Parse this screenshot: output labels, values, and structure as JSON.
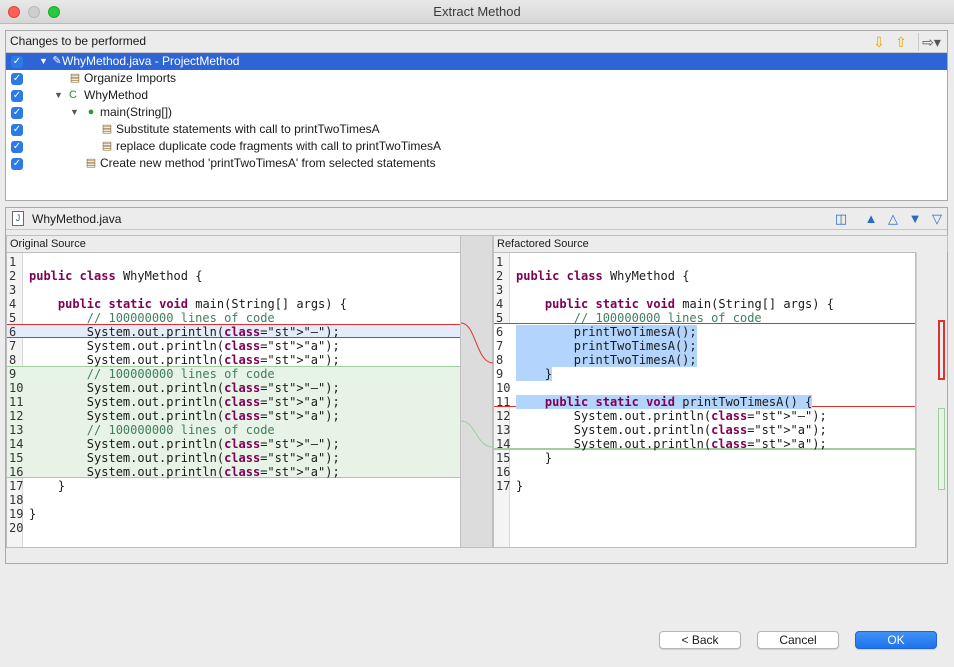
{
  "window": {
    "title": "Extract Method"
  },
  "changes": {
    "header": "Changes to be performed",
    "items": [
      {
        "label": "WhyMethod.java - ProjectMethod",
        "checked": true,
        "icon": "java-file-change-icon"
      },
      {
        "label": "Organize Imports",
        "checked": true,
        "icon": "text-change-icon"
      },
      {
        "label": "WhyMethod",
        "checked": true,
        "icon": "class-icon"
      },
      {
        "label": "main(String[])",
        "checked": true,
        "icon": "method-icon"
      },
      {
        "label": "Substitute statements with call to printTwoTimesA",
        "checked": true,
        "icon": "text-change-icon"
      },
      {
        "label": "replace duplicate code fragments with call to printTwoTimesA",
        "checked": true,
        "icon": "text-change-icon"
      },
      {
        "label": "Create new method 'printTwoTimesA' from selected statements",
        "checked": true,
        "icon": "text-change-icon"
      }
    ]
  },
  "preview": {
    "file": "WhyMethod.java",
    "original_title": "Original Source",
    "refactored_title": "Refactored Source",
    "original_lines": [
      "",
      "public class WhyMethod {",
      "",
      "    public static void main(String[] args) {",
      "        // 100000000 lines of code",
      "        System.out.println(\"—\");",
      "        System.out.println(\"a\");",
      "        System.out.println(\"a\");",
      "        // 100000000 lines of code",
      "        System.out.println(\"—\");",
      "        System.out.println(\"a\");",
      "        System.out.println(\"a\");",
      "        // 100000000 lines of code",
      "        System.out.println(\"—\");",
      "        System.out.println(\"a\");",
      "        System.out.println(\"a\");",
      "    }",
      "",
      "}",
      ""
    ],
    "refactored_lines": [
      "",
      "public class WhyMethod {",
      "",
      "    public static void main(String[] args) {",
      "        // 100000000 lines of code",
      "        printTwoTimesA();",
      "        printTwoTimesA();",
      "        printTwoTimesA();",
      "    }",
      "",
      "    public static void printTwoTimesA() {",
      "        System.out.println(\"—\");",
      "        System.out.println(\"a\");",
      "        System.out.println(\"a\");",
      "    }",
      "",
      "}"
    ]
  },
  "buttons": {
    "back": "< Back",
    "cancel": "Cancel",
    "ok": "OK"
  }
}
